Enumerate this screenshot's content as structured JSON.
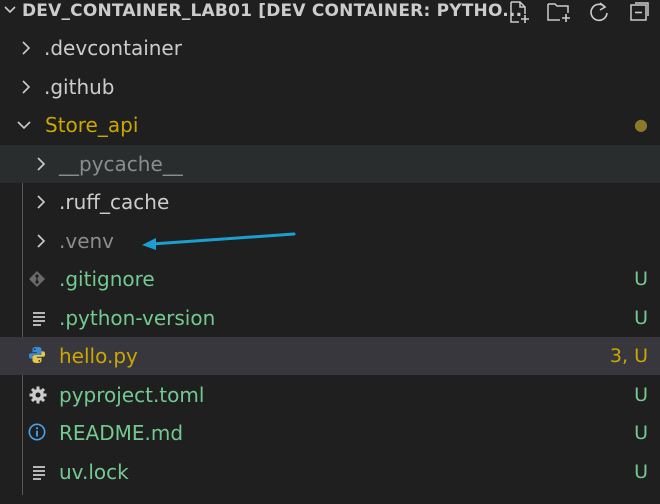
{
  "explorer": {
    "title": "DEV_CONTAINER_LAB01 [DEV CONTAINER: PYTHO...",
    "actions": [
      "new-file-icon",
      "new-folder-icon",
      "refresh-icon",
      "collapse-icon"
    ]
  },
  "tree": [
    {
      "label": ".devcontainer",
      "type": "folder",
      "expanded": false,
      "depth": 0
    },
    {
      "label": ".github",
      "type": "folder",
      "expanded": false,
      "depth": 0
    },
    {
      "label": "Store_api",
      "type": "folder",
      "expanded": true,
      "depth": 0,
      "decoration": "●"
    },
    {
      "label": "__pycache__",
      "type": "folder",
      "expanded": false,
      "depth": 1
    },
    {
      "label": ".ruff_cache",
      "type": "folder",
      "expanded": false,
      "depth": 1
    },
    {
      "label": ".venv",
      "type": "folder",
      "expanded": false,
      "depth": 1
    },
    {
      "label": ".gitignore",
      "type": "file",
      "icon": "git-icon",
      "depth": 1,
      "decoration": "U"
    },
    {
      "label": ".python-version",
      "type": "file",
      "icon": "lines-icon",
      "depth": 1,
      "decoration": "U"
    },
    {
      "label": "hello.py",
      "type": "file",
      "icon": "python-icon",
      "depth": 1,
      "decoration": "3, U"
    },
    {
      "label": "pyproject.toml",
      "type": "file",
      "icon": "gear-icon",
      "depth": 1,
      "decoration": "U"
    },
    {
      "label": "README.md",
      "type": "file",
      "icon": "info-icon",
      "depth": 1,
      "decoration": "U"
    },
    {
      "label": "uv.lock",
      "type": "file",
      "icon": "lines-icon",
      "depth": 1,
      "decoration": "U"
    }
  ],
  "colors": {
    "untracked": "#73c991",
    "modified_warning": "#cca700",
    "folder_modified": "#cca700",
    "ignored": "#8c8c8c",
    "arrow_annotation": "#1a9fd0"
  }
}
